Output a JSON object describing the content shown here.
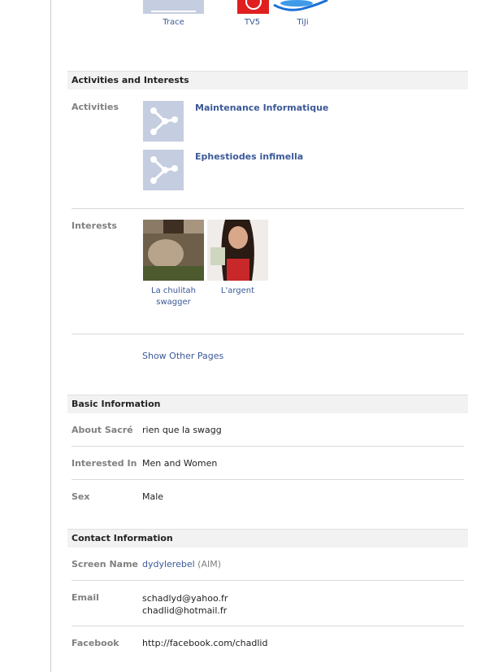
{
  "pages_top": [
    {
      "name": "Trace"
    },
    {
      "name": "TV5"
    },
    {
      "name": "TiJi"
    }
  ],
  "activities_section": {
    "title": "Activities and Interests",
    "activities_label": "Activities",
    "activities": [
      {
        "title": "Maintenance Informatique",
        "icon": "page-network-icon"
      },
      {
        "title": "Ephestiodes infimella",
        "icon": "page-network-icon"
      }
    ],
    "interests_label": "Interests",
    "interests": [
      {
        "line1": "La chulitah",
        "line2": "swagger"
      },
      {
        "line1": "L'argent",
        "line2": ""
      }
    ],
    "show_other": "Show Other Pages"
  },
  "basic_info": {
    "title": "Basic Information",
    "rows": [
      {
        "label": "About Sacré",
        "value": "rien que la swagg"
      },
      {
        "label": "Interested In",
        "value": "Men and Women"
      },
      {
        "label": "Sex",
        "value": "Male"
      }
    ]
  },
  "contact_info": {
    "title": "Contact Information",
    "screen_name_label": "Screen Name",
    "screen_name": "dydylerebel",
    "screen_name_service": "(AIM)",
    "email_label": "Email",
    "emails": [
      "schadlyd@yahoo.fr",
      "chadlid@hotmail.fr"
    ],
    "facebook_label": "Facebook",
    "facebook_url": "http://facebook.com/chadlid"
  },
  "colors": {
    "link": "#3b5998",
    "label": "#808080",
    "header_bg": "#f2f2f2",
    "thumb_bg": "#c5cde0"
  }
}
